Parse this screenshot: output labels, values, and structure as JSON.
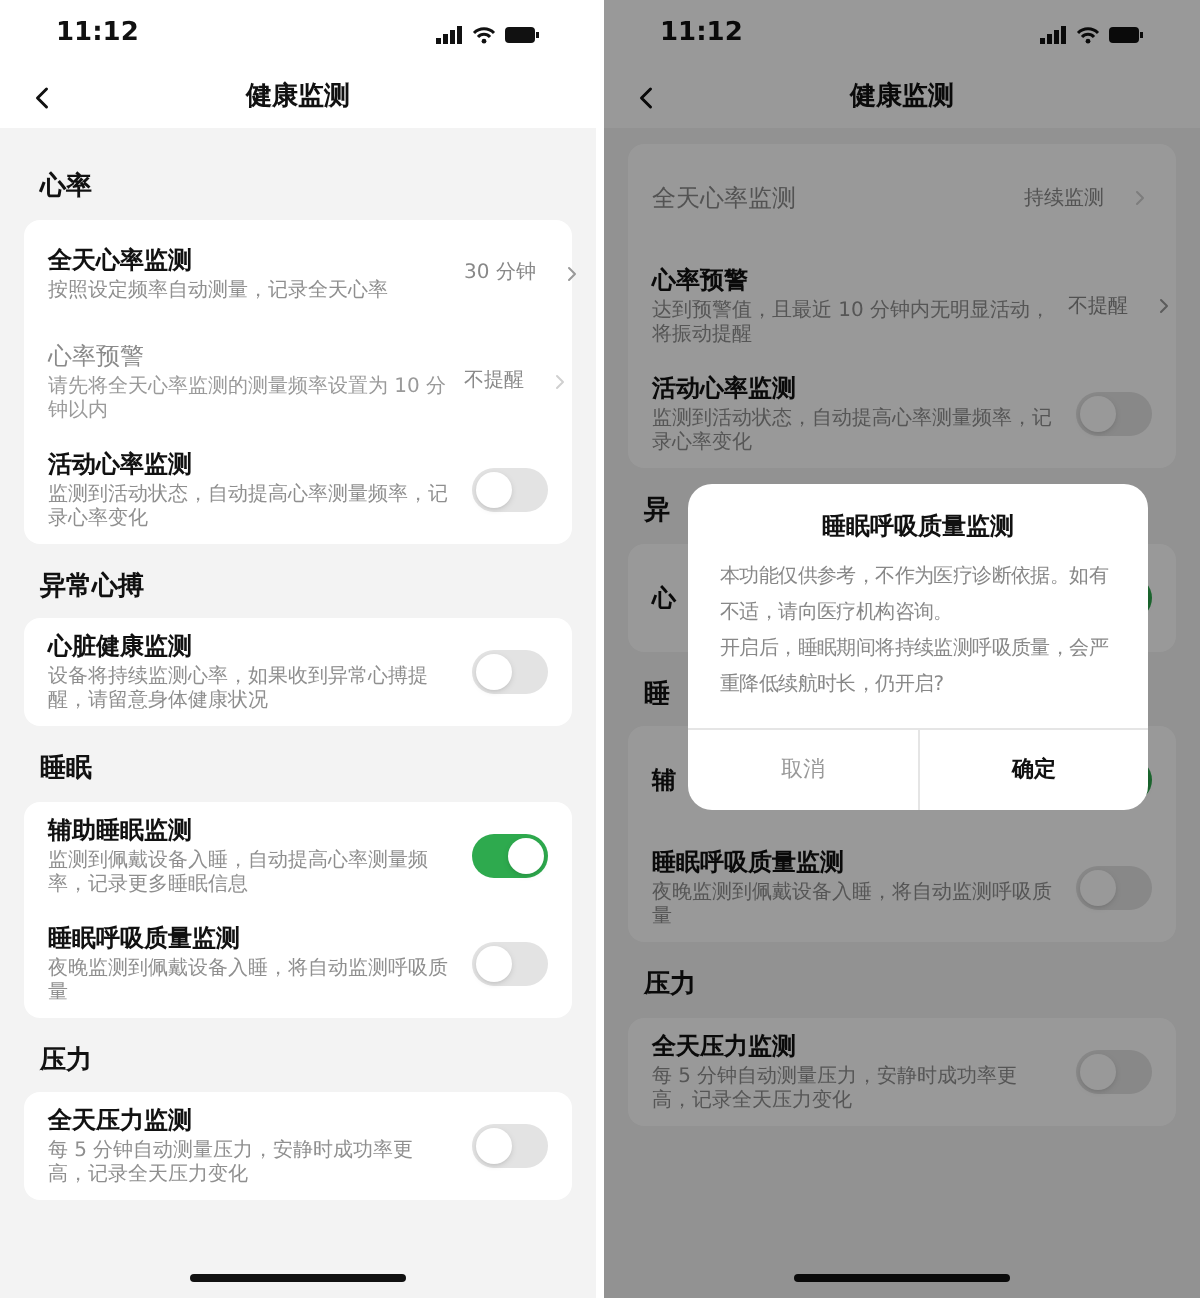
{
  "screens": [
    {
      "status_bar": {
        "time": "11:12"
      },
      "nav": {
        "title": "健康监测"
      },
      "sections": [
        {
          "heading": "心率",
          "rows": [
            {
              "kind": "value",
              "title": "全天心率监测",
              "description": "按照设定频率自动测量，记录全天心率",
              "value": "30 分钟",
              "disabled": false
            },
            {
              "kind": "value",
              "title": "心率预警",
              "description": "请先将全天心率监测的测量频率设置为 10 分钟以内",
              "value": "不提醒",
              "disabled": true
            },
            {
              "kind": "toggle",
              "title": "活动心率监测",
              "description": "监测到活动状态，自动提高心率测量频率，记录心率变化",
              "on": false,
              "disabled": false
            }
          ]
        },
        {
          "heading": "异常心搏",
          "rows": [
            {
              "kind": "toggle",
              "title": "心脏健康监测",
              "description": "设备将持续监测心率，如果收到异常心搏提醒，请留意身体健康状况",
              "on": false,
              "disabled": false
            }
          ]
        },
        {
          "heading": "睡眠",
          "rows": [
            {
              "kind": "toggle",
              "title": "辅助睡眠监测",
              "description": "监测到佩戴设备入睡，自动提高心率测量频率，记录更多睡眠信息",
              "on": true,
              "disabled": false
            },
            {
              "kind": "toggle",
              "title": "睡眠呼吸质量监测",
              "description": "夜晚监测到佩戴设备入睡，将自动监测呼吸质量",
              "on": false,
              "disabled": false
            }
          ]
        },
        {
          "heading": "压力",
          "rows": [
            {
              "kind": "toggle",
              "title": "全天压力监测",
              "description": "每 5 分钟自动测量压力，安静时成功率更高，记录全天压力变化",
              "on": false,
              "disabled": false
            }
          ]
        }
      ]
    },
    {
      "status_bar": {
        "time": "11:12"
      },
      "nav": {
        "title": "健康监测"
      },
      "sections": [
        {
          "rows": [
            {
              "kind": "value",
              "title": "全天心率监测",
              "value": "持续监测",
              "disabled": true
            },
            {
              "kind": "value",
              "title": "心率预警",
              "description": "达到预警值，且最近 10 分钟内无明显活动，将振动提醒",
              "value": "不提醒",
              "disabled": false
            },
            {
              "kind": "toggle",
              "title": "活动心率监测",
              "description": "监测到活动状态，自动提高心率测量频率，记录心率变化",
              "on": false,
              "disabled": false
            }
          ]
        },
        {
          "heading": "异",
          "rows": [
            {
              "kind": "toggle",
              "title": "心",
              "on": true,
              "disabled": false
            }
          ]
        },
        {
          "heading": "睡",
          "rows": [
            {
              "kind": "toggle",
              "title": "辅",
              "on": true,
              "disabled": false
            },
            {
              "kind": "toggle",
              "title": "睡眠呼吸质量监测",
              "description": "夜晚监测到佩戴设备入睡，将自动监测呼吸质量",
              "on": false,
              "disabled": false
            }
          ]
        },
        {
          "heading": "压力",
          "rows": [
            {
              "kind": "toggle",
              "title": "全天压力监测",
              "description": "每 5 分钟自动测量压力，安静时成功率更高，记录全天压力变化",
              "on": false,
              "disabled": false
            }
          ]
        }
      ],
      "dialog": {
        "title": "睡眠呼吸质量监测",
        "paragraphs": [
          "本功能仅供参考，不作为医疗诊断依据。如有不适，请向医疗机构咨询。",
          "开启后，睡眠期间将持续监测呼吸质量，会严重降低续航时长，仍开启?"
        ],
        "buttons": [
          {
            "label": "取消",
            "kind": "cancel"
          },
          {
            "label": "确定",
            "kind": "confirm"
          }
        ]
      }
    }
  ]
}
